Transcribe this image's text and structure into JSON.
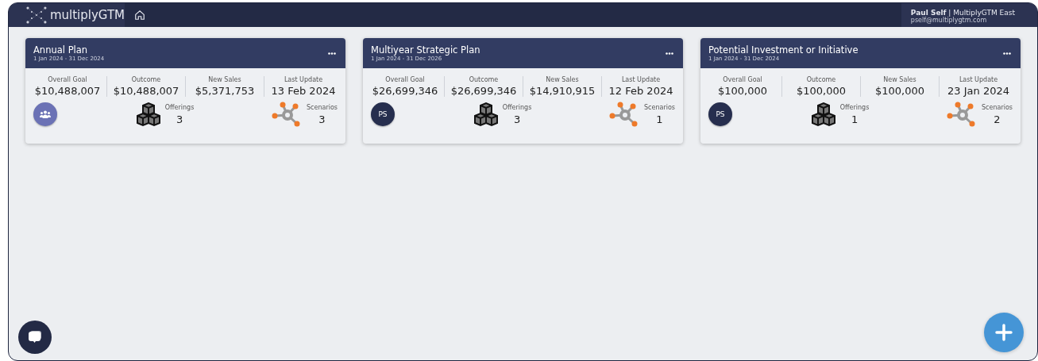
{
  "header": {
    "logo": "multiplyGTM",
    "user_name": "Paul Self",
    "org": "| MultiplyGTM East",
    "email": "pself@multiplygtm.com"
  },
  "plans": [
    {
      "title": "Annual Plan",
      "dates": "1 Jan 2024 - 31 Dec 2024",
      "stats": [
        {
          "label": "Overall Goal",
          "value": "$10,488,007"
        },
        {
          "label": "Outcome",
          "value": "$10,488,007"
        },
        {
          "label": "New Sales",
          "value": "$5,371,753"
        },
        {
          "label": "Last Update",
          "value": "13 Feb 2024"
        }
      ],
      "owner": {
        "kind": "group"
      },
      "offerings": {
        "label": "Offerings",
        "count": "3"
      },
      "scenarios": {
        "label": "Scenarios",
        "count": "3"
      }
    },
    {
      "title": "Multiyear Strategic Plan",
      "dates": "1 Jan 2024 - 31 Dec 2026",
      "stats": [
        {
          "label": "Overall Goal",
          "value": "$26,699,346"
        },
        {
          "label": "Outcome",
          "value": "$26,699,346"
        },
        {
          "label": "New Sales",
          "value": "$14,910,915"
        },
        {
          "label": "Last Update",
          "value": "12 Feb 2024"
        }
      ],
      "owner": {
        "kind": "initials",
        "text": "PS"
      },
      "offerings": {
        "label": "Offerings",
        "count": "3"
      },
      "scenarios": {
        "label": "Scenarios",
        "count": "1"
      }
    },
    {
      "title": "Potential Investment or Initiative",
      "dates": "1 Jan 2024 - 31 Dec 2024",
      "stats": [
        {
          "label": "Overall Goal",
          "value": "$100,000"
        },
        {
          "label": "Outcome",
          "value": "$100,000"
        },
        {
          "label": "New Sales",
          "value": "$100,000"
        },
        {
          "label": "Last Update",
          "value": "23 Jan 2024"
        }
      ],
      "owner": {
        "kind": "initials",
        "text": "PS"
      },
      "offerings": {
        "label": "Offerings",
        "count": "1"
      },
      "scenarios": {
        "label": "Scenarios",
        "count": "2"
      }
    }
  ]
}
